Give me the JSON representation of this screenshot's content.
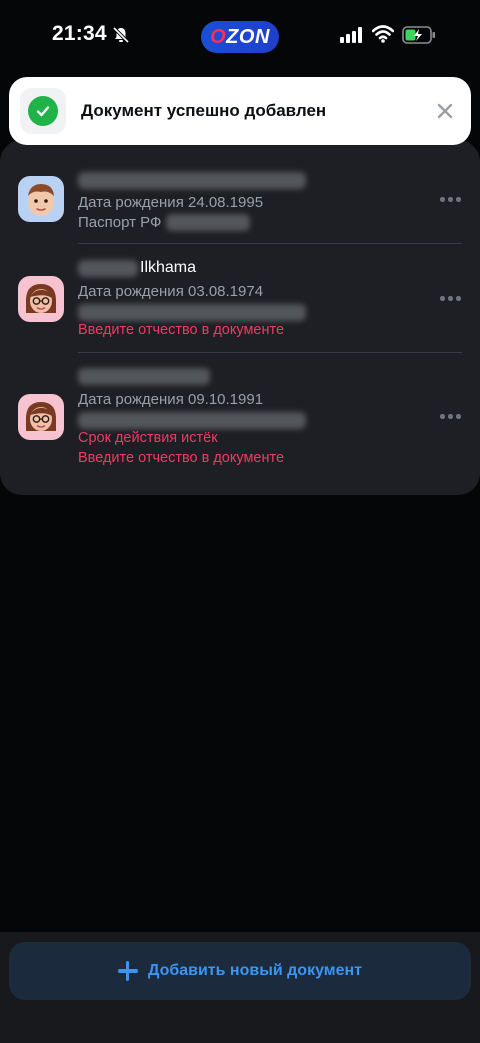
{
  "status_bar": {
    "time": "21:34",
    "brand": "OZON",
    "icons": [
      "bell-muted-icon",
      "signal-icon",
      "wifi-icon",
      "battery-charging-icon"
    ]
  },
  "toast": {
    "message": "Документ успешно добавлен",
    "icon": "check-circle-icon",
    "close_icon": "close-icon"
  },
  "documents": [
    {
      "name_visible": "",
      "birth_date": "Дата рождения 24.08.1995",
      "doc_type": "Паспорт РФ",
      "warnings": [],
      "avatar": "male-avatar"
    },
    {
      "name_visible": "Ilkhama",
      "birth_date": "Дата рождения 03.08.1974",
      "doc_type": "",
      "warnings": [
        "Введите отчество в документе"
      ],
      "avatar": "female-avatar"
    },
    {
      "name_visible": "",
      "birth_date": "Дата рождения 09.10.1991",
      "doc_type": "",
      "warnings": [
        "Срок действия истёк",
        "Введите отчество в документе"
      ],
      "avatar": "female-avatar"
    }
  ],
  "actions": {
    "add_document": "Добавить новый документ"
  },
  "colors": {
    "accent_blue": "#3d95f2",
    "warning_red": "#f03a64",
    "success_green": "#1fb34a",
    "panel_bg": "#1d1f24"
  }
}
